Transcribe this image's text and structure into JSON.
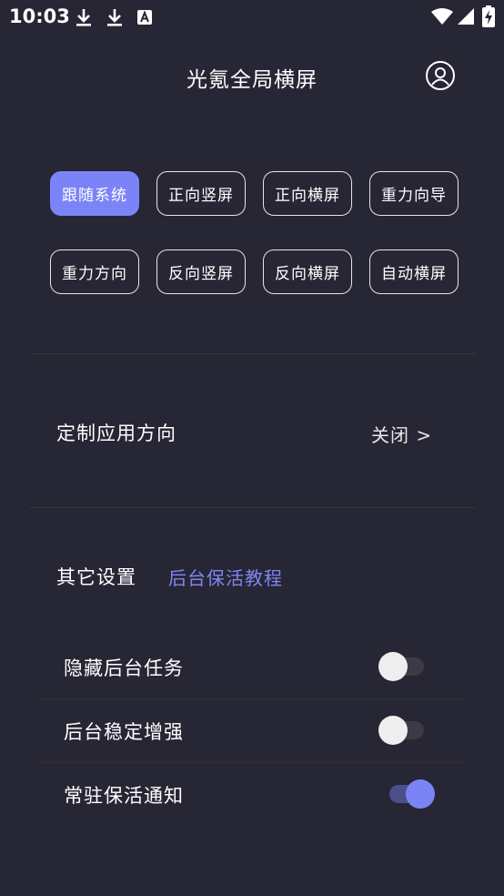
{
  "status_bar": {
    "time": "10:03",
    "icons": [
      "download-icon",
      "download-icon",
      "font-a-icon",
      "wifi-icon",
      "signal-icon",
      "battery-charging-icon"
    ]
  },
  "header": {
    "title": "光氪全局横屏",
    "account_icon": "user-circle-icon"
  },
  "orientation_modes": {
    "selected_index": 0,
    "accent_color": "#7b84f7",
    "buttons": [
      {
        "label": "跟随系统"
      },
      {
        "label": "正向竖屏"
      },
      {
        "label": "正向横屏"
      },
      {
        "label": "重力向导"
      },
      {
        "label": "重力方向"
      },
      {
        "label": "反向竖屏"
      },
      {
        "label": "反向横屏"
      },
      {
        "label": "自动横屏"
      }
    ]
  },
  "custom_orientation": {
    "label": "定制应用方向",
    "value": "关闭 >"
  },
  "other_settings": {
    "label": "其它设置",
    "link": "后台保活教程",
    "items": [
      {
        "label": "隐藏后台任务",
        "enabled": false
      },
      {
        "label": "后台稳定增强",
        "enabled": false
      },
      {
        "label": "常驻保活通知",
        "enabled": true
      }
    ]
  }
}
